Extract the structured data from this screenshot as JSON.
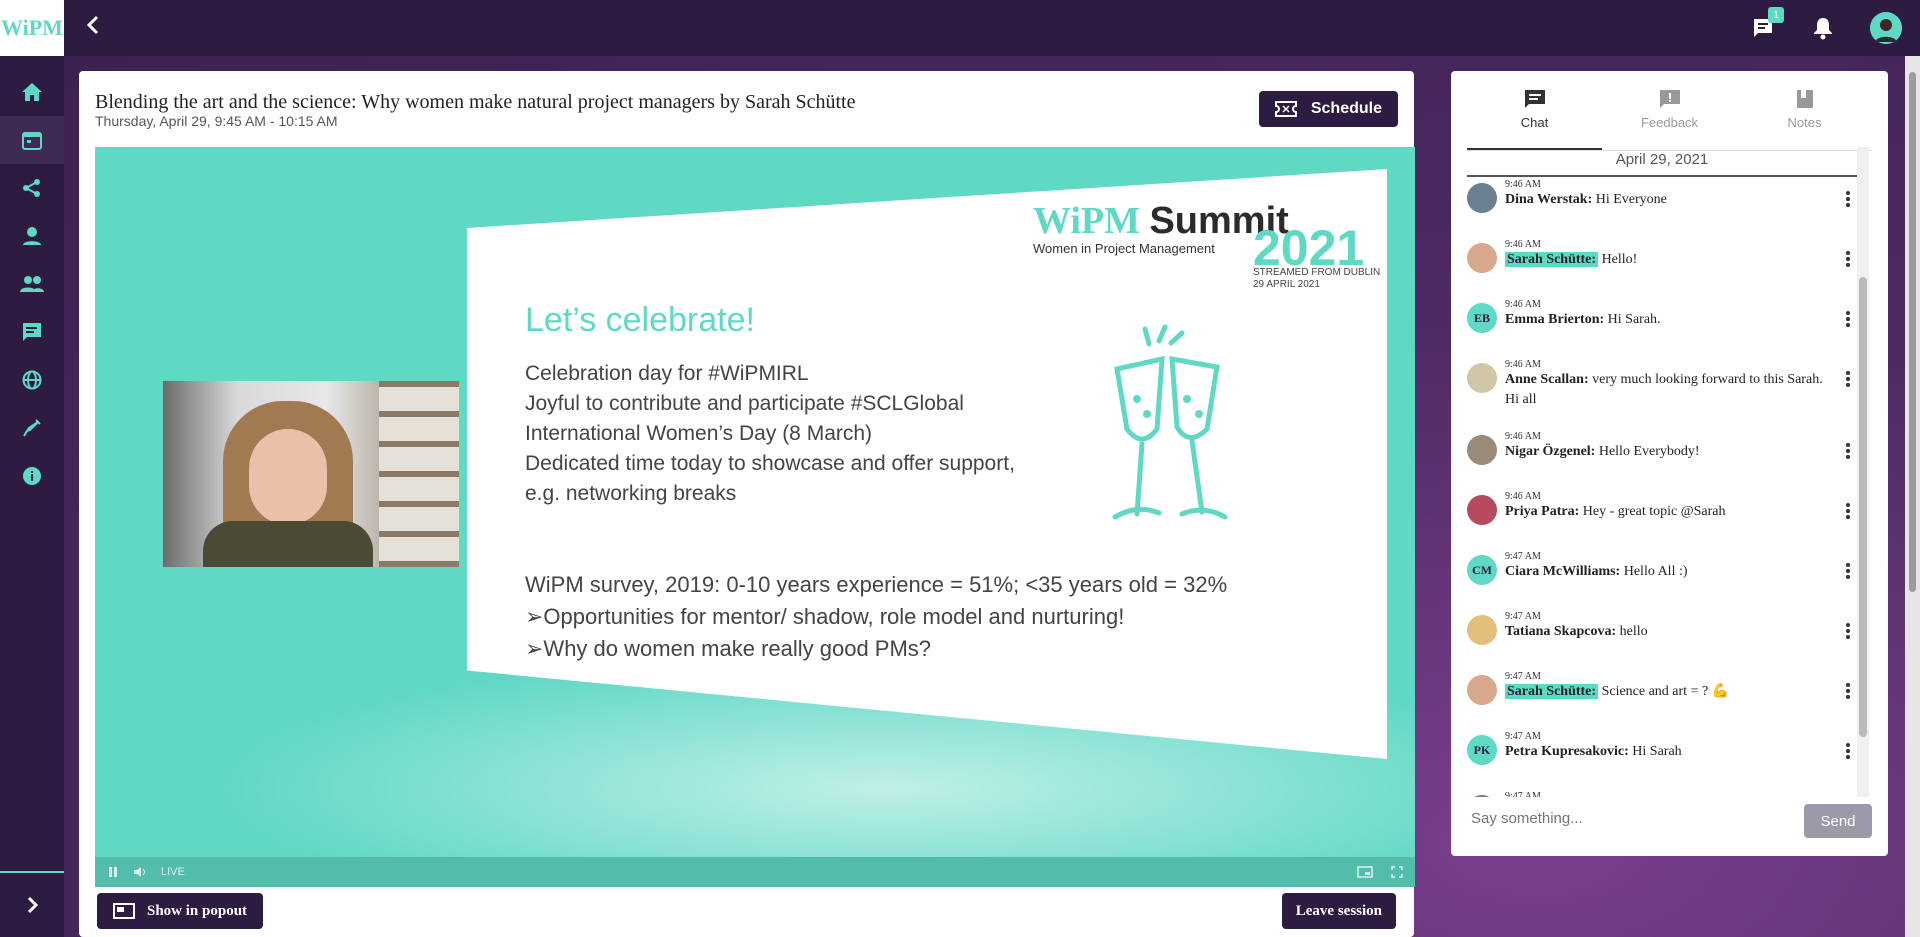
{
  "app": {
    "logo": "WiPM"
  },
  "topbar": {
    "back_icon": "chevron-left-icon",
    "messages_badge": "1",
    "icons": [
      "chat-icon",
      "bell-icon",
      "avatar"
    ]
  },
  "sidebar": {
    "items": [
      {
        "icon": "home-icon"
      },
      {
        "icon": "calendar-icon",
        "active": true
      },
      {
        "icon": "share-icon"
      },
      {
        "icon": "person-icon"
      },
      {
        "icon": "people-icon"
      },
      {
        "icon": "chat-list-icon"
      },
      {
        "icon": "globe-icon"
      },
      {
        "icon": "syringe-icon"
      },
      {
        "icon": "info-icon"
      }
    ],
    "expand_icon": "chevron-right-icon"
  },
  "session": {
    "title": "Blending the art and the science: Why women make natural project managers by Sarah Schütte",
    "time": "Thursday, April 29, 9:45 AM - 10:15 AM",
    "schedule_label": "Schedule",
    "popout_label": "Show in popout",
    "leave_label": "Leave session"
  },
  "video": {
    "live_label": "LIVE",
    "slide": {
      "brand_left": "WiPM",
      "brand_right": "Summit",
      "year": "2021",
      "subtitle": "Women in Project Management",
      "stream_line1": "STREAMED FROM DUBLIN",
      "stream_line2": "29 APRIL 2021",
      "heading": "Let’s celebrate!",
      "bullets": [
        "Celebration day for #WiPMIRL",
        "Joyful to contribute and participate #SCLGlobal",
        "International Women’s Day (8 March)",
        "Dedicated time today to showcase and offer support,",
        "e.g. networking breaks"
      ],
      "survey": "WiPM survey, 2019: 0-10 years experience = 51%; <35 years old = 32%",
      "points": [
        "➢Opportunities for mentor/ shadow, role model and nurturing!",
        "➢Why do women make really good PMs?"
      ]
    }
  },
  "chat": {
    "tabs": [
      {
        "label": "Chat",
        "icon": "chat-icon",
        "active": true
      },
      {
        "label": "Feedback",
        "icon": "feedback-icon"
      },
      {
        "label": "Notes",
        "icon": "notes-icon"
      }
    ],
    "date": "April 29, 2021",
    "messages": [
      {
        "time": "9:46 AM",
        "name": "Dina Werstak:",
        "text": "Hi Everyone",
        "avatar_color": "#6a7f92",
        "initials": "",
        "highlight": false
      },
      {
        "time": "9:46 AM",
        "name": "Sarah Schütte:",
        "text": "Hello!",
        "avatar_color": "#d8a98a",
        "initials": "",
        "highlight": true
      },
      {
        "time": "9:46 AM",
        "name": "Emma Brierton:",
        "text": "Hi Sarah.",
        "avatar_color": "#5fd8c4",
        "initials": "EB",
        "highlight": false
      },
      {
        "time": "9:46 AM",
        "name": "Anne Scallan:",
        "text": "very much looking forward to this Sarah. Hi all",
        "avatar_color": "#cfc7a5",
        "initials": "",
        "highlight": false
      },
      {
        "time": "9:46 AM",
        "name": "Nigar Özgenel:",
        "text": "Hello Everybody!",
        "avatar_color": "#9a8a7a",
        "initials": "",
        "highlight": false
      },
      {
        "time": "9:46 AM",
        "name": "Priya Patra:",
        "text": "Hey - great topic @Sarah",
        "avatar_color": "#b54b5c",
        "initials": "",
        "highlight": false
      },
      {
        "time": "9:47 AM",
        "name": "Ciara McWilliams:",
        "text": "Hello All :)",
        "avatar_color": "#5fd8c4",
        "initials": "CM",
        "highlight": false
      },
      {
        "time": "9:47 AM",
        "name": "Tatiana Skapcova:",
        "text": "hello",
        "avatar_color": "#e3c07a",
        "initials": "",
        "highlight": false
      },
      {
        "time": "9:47 AM",
        "name": "Sarah Schütte:",
        "text": "Science and art = ? 💪",
        "avatar_color": "#d8a98a",
        "initials": "",
        "highlight": true
      },
      {
        "time": "9:47 AM",
        "name": "Petra Kupresakovic:",
        "text": "Hi Sarah",
        "avatar_color": "#5fd8c4",
        "initials": "PK",
        "highlight": false
      },
      {
        "time": "9:47 AM",
        "name": "",
        "text": "",
        "avatar_color": "#6a7f92",
        "initials": "",
        "highlight": false
      }
    ],
    "input_placeholder": "Say something...",
    "send_label": "Send"
  },
  "colors": {
    "brand_dark": "#2d1b42",
    "accent": "#5fd8c4"
  }
}
